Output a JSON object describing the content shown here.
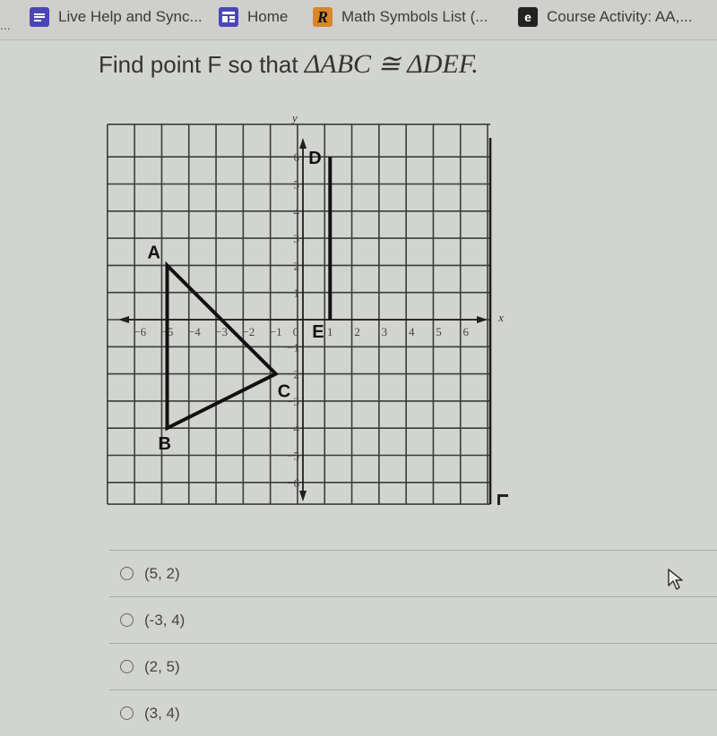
{
  "bookmarks": [
    {
      "label": "Live Help and Sync...",
      "icon": "docs-icon"
    },
    {
      "label": "Home",
      "icon": "home-layout-icon"
    },
    {
      "label": "Math Symbols List (...",
      "icon": "r-logo-icon",
      "glyph": "R"
    },
    {
      "label": "Course Activity: AA,...",
      "icon": "course-e-icon",
      "glyph": "e"
    }
  ],
  "overflow_label": "...",
  "question": {
    "prefix": "Find point F so that",
    "math": "ΔABC ≅ ΔDEF."
  },
  "graph": {
    "x_axis_label": "x",
    "y_axis_label": "y",
    "x_ticks": [
      "-6",
      "-5",
      "-4",
      "-3",
      "-2",
      "-1",
      "0",
      "1",
      "2",
      "3",
      "4",
      "5",
      "6"
    ],
    "y_ticks": [
      "6",
      "5",
      "4",
      "3",
      "2",
      "1",
      "-1",
      "-2",
      "-3",
      "-4",
      "-5",
      "-6"
    ],
    "points": [
      {
        "label": "A",
        "x": -5,
        "y": 2
      },
      {
        "label": "B",
        "x": -5,
        "y": -4
      },
      {
        "label": "C",
        "x": -1,
        "y": -2
      },
      {
        "label": "D",
        "x": 1,
        "y": 6
      },
      {
        "label": "E",
        "x": 1,
        "y": 0
      }
    ],
    "triangle": [
      "A",
      "B",
      "C"
    ],
    "segment": [
      "D",
      "E"
    ]
  },
  "answer_options": [
    {
      "label": "(5, 2)",
      "selected": false
    },
    {
      "label": "(-3, 4)",
      "selected": false
    },
    {
      "label": "(2, 5)",
      "selected": false
    },
    {
      "label": "(3, 4)",
      "selected": false
    }
  ]
}
